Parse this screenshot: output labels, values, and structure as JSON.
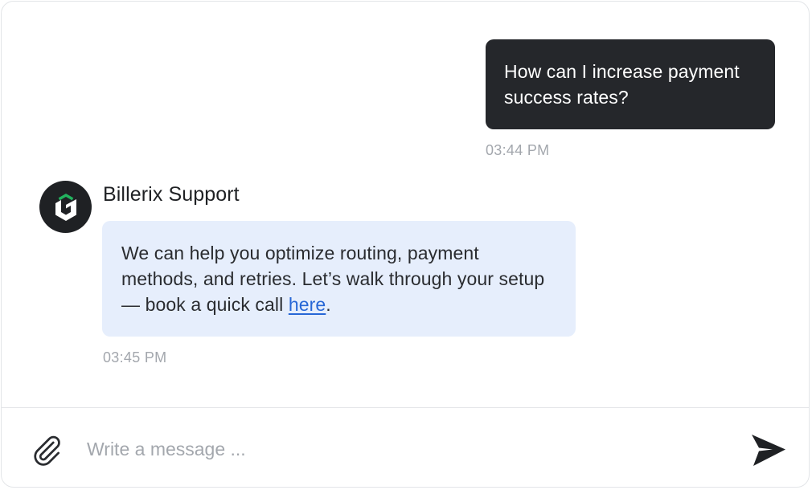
{
  "conversation": {
    "user_message": {
      "text": "How can I increase payment success rates?",
      "time": "03:44 PM"
    },
    "agent": {
      "name": "Billerix Support",
      "avatar_icon": "billerix-logo-icon",
      "message_text_before_link": "We can help you optimize routing, payment methods, and retries. Let’s walk through your setup — book a quick call ",
      "link_label": "here",
      "message_text_after_link": ".",
      "time": "03:45 PM"
    }
  },
  "composer": {
    "placeholder": "Write a message ...",
    "value": "",
    "attach_icon": "paperclip-icon",
    "send_icon": "send-icon"
  },
  "colors": {
    "user_bubble": "#25272b",
    "agent_bubble": "#e6eefc",
    "link": "#2767d6",
    "logo_accent": "#22b35e",
    "timestamp": "#a3a7ad"
  }
}
